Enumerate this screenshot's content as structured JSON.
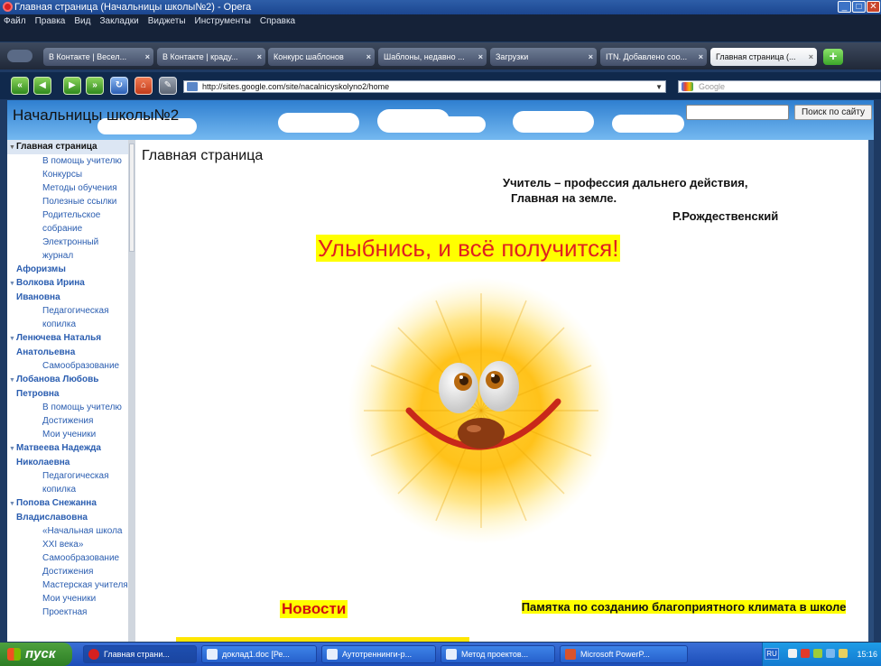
{
  "window": {
    "title": "Главная страница (Начальницы школы№2) - Opera"
  },
  "menu": [
    "Файл",
    "Правка",
    "Вид",
    "Закладки",
    "Виджеты",
    "Инструменты",
    "Справка"
  ],
  "tabs": [
    {
      "label": "В Контакте | Весел..."
    },
    {
      "label": "В Контакте | краду..."
    },
    {
      "label": "Конкурс шаблонов"
    },
    {
      "label": "Шаблоны, недавно ..."
    },
    {
      "label": "Загрузки"
    },
    {
      "label": "ITN. Добавлено соо..."
    },
    {
      "label": "Главная страница (..."
    }
  ],
  "address": {
    "url": "http://sites.google.com/site/nacalnicyskolyno2/home",
    "search_engine": "Google"
  },
  "site": {
    "title": "Начальницы школы№2",
    "search_button": "Поиск по сайту"
  },
  "sidebar": [
    {
      "label": "Главная страница",
      "level": "head",
      "expanded": true
    },
    {
      "label": "В помощь учителю",
      "level": "lvl2"
    },
    {
      "label": "Конкурсы",
      "level": "lvl2"
    },
    {
      "label": "Методы обучения",
      "level": "lvl2"
    },
    {
      "label": "Полезные ссылки",
      "level": "lvl2"
    },
    {
      "label": "Родительское собрание",
      "level": "lvl2"
    },
    {
      "label": "Электронный журнал",
      "level": "lvl2"
    },
    {
      "label": "Афоризмы",
      "level": "lvl1",
      "expanded": false
    },
    {
      "label": "Волкова Ирина Ивановна",
      "level": "lvl1",
      "expanded": true
    },
    {
      "label": "Педагогическая копилка",
      "level": "lvl2"
    },
    {
      "label": "Ленючева Наталья Анатольевна",
      "level": "lvl1",
      "expanded": true
    },
    {
      "label": "Самообразование",
      "level": "lvl2"
    },
    {
      "label": "Лобанова Любовь Петровна",
      "level": "lvl1",
      "expanded": true
    },
    {
      "label": "В помощь учителю",
      "level": "lvl2"
    },
    {
      "label": "Достижения",
      "level": "lvl2"
    },
    {
      "label": "Мои ученики",
      "level": "lvl2"
    },
    {
      "label": "Матвеева Надежда Николаевна",
      "level": "lvl1",
      "expanded": true
    },
    {
      "label": "Педагогическая копилка",
      "level": "lvl2"
    },
    {
      "label": "Попова Снежанна Владиславовна",
      "level": "lvl1",
      "expanded": true
    },
    {
      "label": "«Начальная школа XXI века»",
      "level": "lvl2"
    },
    {
      "label": "Самообразование",
      "level": "lvl2"
    },
    {
      "label": "Достижения",
      "level": "lvl2"
    },
    {
      "label": "Мастерская учителя",
      "level": "lvl2"
    },
    {
      "label": "Мои ученики",
      "level": "lvl2"
    },
    {
      "label": "Проектная",
      "level": "lvl2"
    }
  ],
  "content": {
    "page_title": "Главная страница",
    "quote_line1": "Учитель – профессия дальнего действия,",
    "quote_line2": "Главная на земле.",
    "quote_author": "Р.Рождественский",
    "slogan": "Улыбнись, и всё получится!",
    "news": "Новости",
    "memo": "Памятка по созданию благоприятного климата в школе"
  },
  "taskbar": {
    "start": "пуск",
    "buttons": [
      {
        "label": "Главная страни...",
        "icon": "opera-icon"
      },
      {
        "label": "доклад1.doc [Ре...",
        "icon": "word-icon"
      },
      {
        "label": "Аутотреннинги-р...",
        "icon": "word-icon"
      },
      {
        "label": "Метод проектов...",
        "icon": "word-icon"
      },
      {
        "label": "Microsoft PowerP...",
        "icon": "powerpoint-icon"
      }
    ],
    "lang": "RU",
    "clock": "15:16"
  }
}
